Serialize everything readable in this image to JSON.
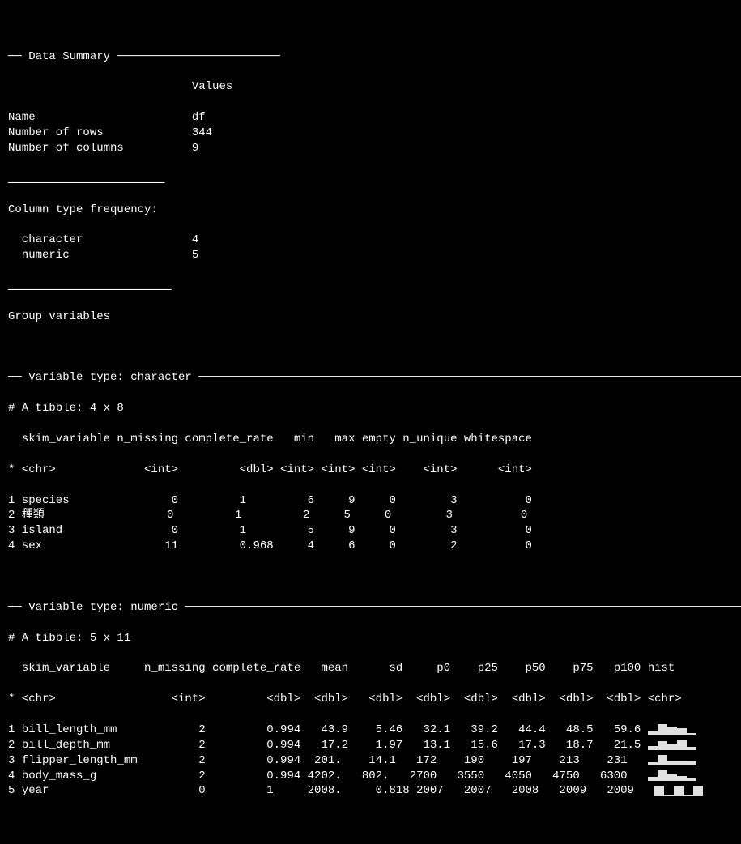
{
  "header": {
    "title": "── Data Summary ────────────────────────",
    "values_col": "Values",
    "rows": [
      {
        "label": "Name",
        "value": "df"
      },
      {
        "label": "Number of rows",
        "value": "344"
      },
      {
        "label": "Number of columns",
        "value": "9"
      }
    ],
    "underline1": "_______________________",
    "ctf_label": "Column type frequency:",
    "ctf_rows": [
      {
        "label": "  character",
        "value": "4"
      },
      {
        "label": "  numeric",
        "value": "5"
      }
    ],
    "underline2": "________________________",
    "group_vars": "Group variables"
  },
  "char_section": {
    "title": "── Variable type: character ────────────────────────────────────────────────────────────────────────────────",
    "tibble": "# A tibble: 4 x 8",
    "header": "  skim_variable n_missing complete_rate   min   max empty n_unique whitespace",
    "types": "* <chr>             <int>         <dbl> <int> <int> <int>    <int>      <int>",
    "rows": [
      "1 species               0         1         6     9     0        3          0",
      "2 種類                  0         1         2     5     0        3          0",
      "3 island                0         1         5     9     0        3          0",
      "4 sex                  11         0.968     4     6     0        2          0"
    ]
  },
  "num_section": {
    "title": "── Variable type: numeric ──────────────────────────────────────────────────────────────────────────────────",
    "tibble": "# A tibble: 5 x 11",
    "header": "  skim_variable     n_missing complete_rate   mean      sd     p0    p25    p50    p75   p100 hist",
    "types": "* <chr>                 <int>         <dbl>  <dbl>   <dbl>  <dbl>  <dbl>  <dbl>  <dbl>  <dbl> <chr>",
    "rows": [
      {
        "text": "1 bill_length_mm            2         0.994   43.9    5.46   32.1   39.2   44.4   48.5   59.6 ",
        "hist": [
          0.25,
          0.95,
          0.65,
          0.55,
          0.15
        ]
      },
      {
        "text": "2 bill_depth_mm             2         0.994   17.2    1.97   13.1   15.6   17.3   18.7   21.5 ",
        "hist": [
          0.35,
          0.75,
          0.55,
          0.95,
          0.3
        ]
      },
      {
        "text": "3 flipper_length_mm         2         0.994  201.    14.1   172    190    197    213    231   ",
        "hist": [
          0.3,
          0.95,
          0.45,
          0.4,
          0.35
        ]
      },
      {
        "text": "4 body_mass_g               2         0.994 4202.   802.   2700   3550   4050   4750   6300   ",
        "hist": [
          0.35,
          0.95,
          0.55,
          0.45,
          0.25
        ]
      },
      {
        "text": "5 year                      0         1     2008.     0.818 2007   2007   2008   2009   2009   ",
        "hist": [
          0.95,
          0.05,
          0.95,
          0.05,
          0.95
        ]
      }
    ]
  }
}
